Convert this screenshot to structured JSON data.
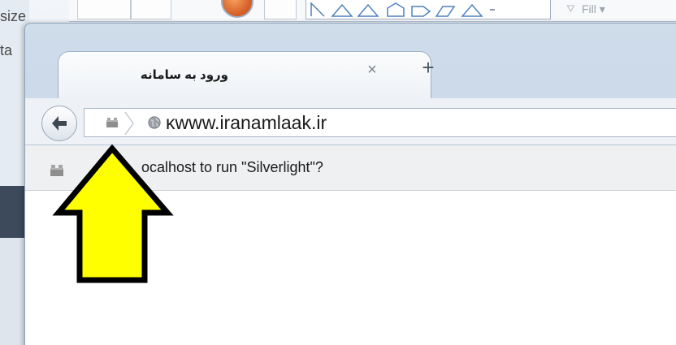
{
  "background_app": {
    "left_labels": [
      "size",
      "ta"
    ],
    "fill_label": "Fill ▾"
  },
  "browser": {
    "tab": {
      "title": "ورود به سامانه",
      "close_glyph": "×"
    },
    "new_tab_glyph": "+",
    "url": "ĸwww.iranamlaak.ir",
    "notification": {
      "text": "ocalhost to run \"Silverlight\"?"
    }
  },
  "annotation": {
    "arrow_color": "#ffff00",
    "arrow_outline": "#000000"
  },
  "colors": {
    "window_frame": "#c3d3e5",
    "nav_bar": "#eef2f6",
    "notification_bar": "#eef0f2"
  }
}
